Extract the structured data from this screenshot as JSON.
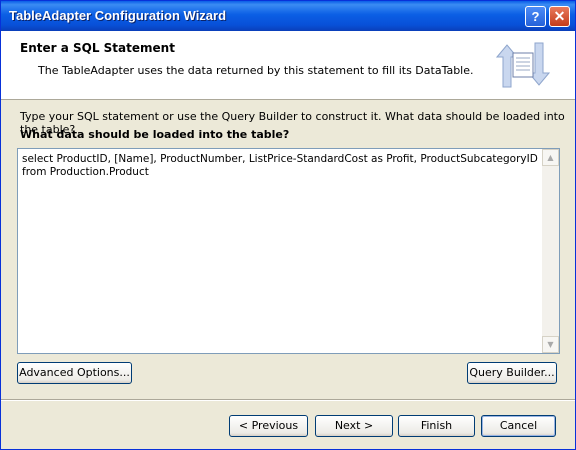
{
  "window": {
    "title": "TableAdapter Configuration Wizard"
  },
  "titlebar_buttons": {
    "help": "?",
    "close": "✕"
  },
  "header": {
    "title": "Enter a SQL Statement",
    "description": "The TableAdapter uses the data returned by this statement to fill its DataTable."
  },
  "body": {
    "instruction": "Type your SQL statement or use the Query Builder to construct it. What data should be loaded into the table?",
    "prompt_label": "What data should be loaded into the table?",
    "sql_text": "select ProductID, [Name], ProductNumber, ListPrice-StandardCost as Profit, ProductSubcategoryID\nfrom Production.Product"
  },
  "buttons": {
    "advanced_options": "Advanced Options...",
    "query_builder": "Query Builder...",
    "previous": "< Previous",
    "next": "Next >",
    "finish": "Finish",
    "cancel": "Cancel"
  },
  "scrollbar": {
    "up": "▲",
    "down": "▼"
  }
}
